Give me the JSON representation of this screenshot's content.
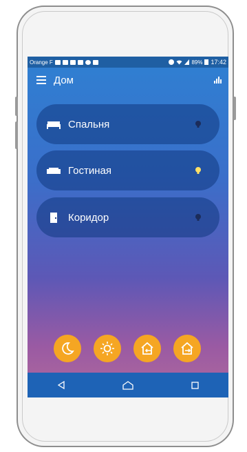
{
  "status_bar": {
    "carrier": "Orange F",
    "battery": "89%",
    "time": "17:42"
  },
  "app_bar": {
    "title": "Дом",
    "menu_icon": "hamburger-icon",
    "stats_icon": "bar-chart-icon"
  },
  "rooms": [
    {
      "label": "Спальня",
      "icon": "bed-icon",
      "light_on": false
    },
    {
      "label": "Гостиная",
      "icon": "sofa-icon",
      "light_on": true
    },
    {
      "label": "Коридор",
      "icon": "door-icon",
      "light_on": false
    }
  ],
  "actions": [
    {
      "icon": "moon-icon"
    },
    {
      "icon": "sun-icon"
    },
    {
      "icon": "home-enter-icon"
    },
    {
      "icon": "home-exit-icon"
    }
  ],
  "nav": [
    "back-icon",
    "home-icon",
    "recents-icon"
  ],
  "colors": {
    "accent": "#f5a623",
    "bulb_on": "#ffe066",
    "bulb_off": "#1b2c5a",
    "bar": "#1e63b6"
  }
}
